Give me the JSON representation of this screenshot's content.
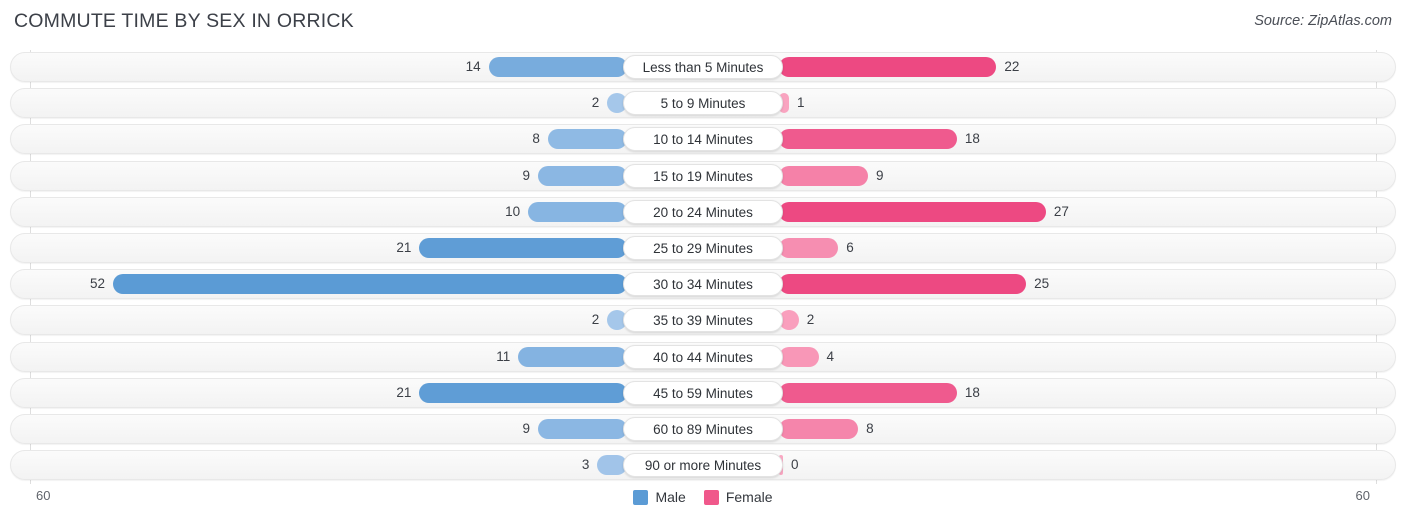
{
  "header": {
    "title": "COMMUTE TIME BY SEX IN ORRICK",
    "source": "Source: ZipAtlas.com"
  },
  "legend": {
    "items": [
      {
        "label": "Male",
        "color": "#5B9BD5"
      },
      {
        "label": "Female",
        "color": "#F0588B"
      }
    ]
  },
  "axis": {
    "left_tick": "60",
    "right_tick": "60",
    "max": 60
  },
  "chart_data": {
    "type": "bar",
    "subtype": "diverging-butterfly",
    "title": "COMMUTE TIME BY SEX IN ORRICK",
    "xlabel": "",
    "ylabel": "",
    "xlim": [
      60,
      60
    ],
    "grid": false,
    "legend_position": "bottom-center",
    "categories": [
      "Less than 5 Minutes",
      "5 to 9 Minutes",
      "10 to 14 Minutes",
      "15 to 19 Minutes",
      "20 to 24 Minutes",
      "25 to 29 Minutes",
      "30 to 34 Minutes",
      "35 to 39 Minutes",
      "40 to 44 Minutes",
      "45 to 59 Minutes",
      "60 to 89 Minutes",
      "90 or more Minutes"
    ],
    "series": [
      {
        "name": "Male",
        "direction": "left",
        "color": "#5B9BD5",
        "values": [
          14,
          2,
          8,
          9,
          10,
          21,
          52,
          2,
          11,
          21,
          9,
          3
        ]
      },
      {
        "name": "Female",
        "direction": "right",
        "color": "#F0588B",
        "values": [
          22,
          1,
          18,
          9,
          27,
          6,
          25,
          2,
          4,
          18,
          8,
          0
        ]
      }
    ]
  },
  "rows": [
    {
      "category": "Less than 5 Minutes",
      "male": "14",
      "female": "22"
    },
    {
      "category": "5 to 9 Minutes",
      "male": "2",
      "female": "1"
    },
    {
      "category": "10 to 14 Minutes",
      "male": "8",
      "female": "18"
    },
    {
      "category": "15 to 19 Minutes",
      "male": "9",
      "female": "9"
    },
    {
      "category": "20 to 24 Minutes",
      "male": "10",
      "female": "27"
    },
    {
      "category": "25 to 29 Minutes",
      "male": "21",
      "female": "6"
    },
    {
      "category": "30 to 34 Minutes",
      "male": "52",
      "female": "25"
    },
    {
      "category": "35 to 39 Minutes",
      "male": "2",
      "female": "2"
    },
    {
      "category": "40 to 44 Minutes",
      "male": "11",
      "female": "4"
    },
    {
      "category": "45 to 59 Minutes",
      "male": "21",
      "female": "18"
    },
    {
      "category": "60 to 89 Minutes",
      "male": "9",
      "female": "8"
    },
    {
      "category": "90 or more Minutes",
      "male": "3",
      "female": "0"
    }
  ]
}
